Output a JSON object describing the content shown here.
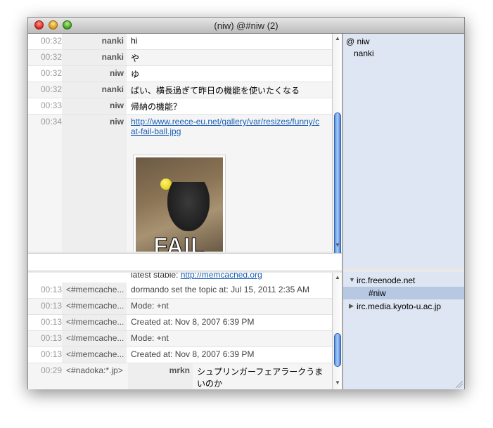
{
  "window": {
    "title": "(niw) @#niw (2)"
  },
  "top_log": {
    "rows": [
      {
        "time": "00:32",
        "nick": "nanki",
        "msg": "hi"
      },
      {
        "time": "00:32",
        "nick": "nanki",
        "msg": "や"
      },
      {
        "time": "00:32",
        "nick": "niw",
        "msg": "ゆ"
      },
      {
        "time": "00:32",
        "nick": "nanki",
        "msg": "ばい、横長過ぎて昨日の機能を使いたくなる"
      },
      {
        "time": "00:33",
        "nick": "niw",
        "msg": "帰納の機能？"
      },
      {
        "time": "00:34",
        "nick": "niw",
        "link": "http://www.reece-eu.net/gallery/var/resizes/funny/cat-fail-ball.jpg",
        "link_line1": "http://www.reece-eu.net/gallery/var/resizes/funny/c",
        "link_line2": "at-fail-ball.jpg",
        "image_caption": "FAIL"
      }
    ]
  },
  "bottom_log": {
    "partial_text": "latest stable: ",
    "partial_link": "http://memcached.org",
    "rows": [
      {
        "time": "00:13",
        "nick": "<#memcache...",
        "msg": "dormando set the topic at: Jul 15, 2011 2:35 AM"
      },
      {
        "time": "00:13",
        "nick": "<#memcache...",
        "msg": "Mode: +nt"
      },
      {
        "time": "00:13",
        "nick": "<#memcache...",
        "msg": "Created at: Nov 8, 2007 6:39 PM"
      },
      {
        "time": "00:13",
        "nick": "<#memcache...",
        "msg": "Mode: +nt"
      },
      {
        "time": "00:13",
        "nick": "<#memcache...",
        "msg": "Created at: Nov 8, 2007 6:39 PM"
      },
      {
        "time": "00:29",
        "nick": "<#nadoka:*.jp>",
        "sub_nick": "mrkn",
        "msg_line1": "シュプリンガーフェアラークうま",
        "msg_line2": "いのか"
      }
    ]
  },
  "members": [
    {
      "prefix": "@",
      "name": "niw"
    },
    {
      "prefix": "",
      "name": "nanki"
    }
  ],
  "servers": [
    {
      "name": "irc.freenode.net",
      "expanded": true,
      "channels": [
        "#niw"
      ]
    },
    {
      "name": "irc.media.kyoto-u.ac.jp",
      "expanded": false,
      "channels": []
    }
  ],
  "icons": {
    "close": "close-icon",
    "minimize": "minimize-icon",
    "zoom": "zoom-icon",
    "expand": "disclosure-triangle-icon",
    "resize": "resize-grip-icon"
  }
}
